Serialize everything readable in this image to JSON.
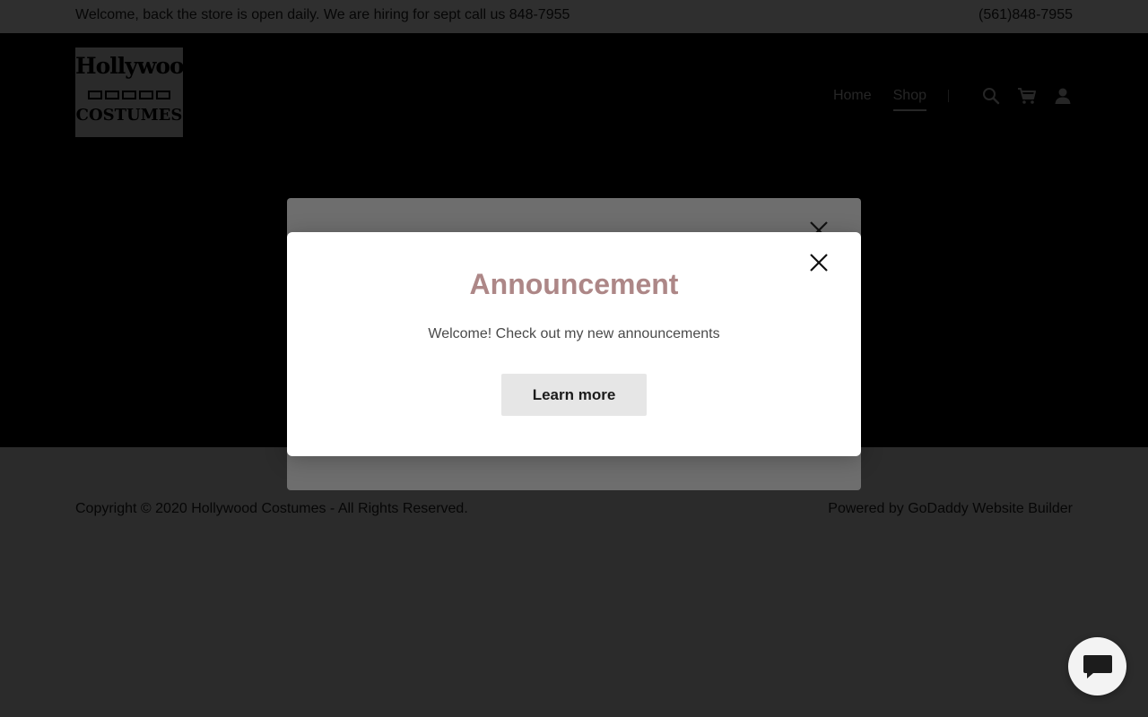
{
  "topbar": {
    "message": "Welcome, back the store is open daily. We are hiring for sept call us 848-7955",
    "phone": "(561)848-7955"
  },
  "logo": {
    "line1": "Hollywood",
    "line2": "COSTUMES"
  },
  "nav": {
    "items": [
      {
        "label": "Home",
        "active": false
      },
      {
        "label": "Shop",
        "active": true
      }
    ],
    "icons": [
      "search-icon",
      "cart-icon",
      "account-icon"
    ]
  },
  "footer": {
    "copyright": "Copyright © 2020 Hollywood Costumes - All Rights Reserved.",
    "powered": "Powered by GoDaddy Website Builder"
  },
  "modal": {
    "title": "Announcement",
    "text": "Welcome! Check out my new announcements",
    "button": "Learn more",
    "close_icon": "close-icon"
  },
  "chat": {
    "icon": "chat-icon"
  },
  "colors": {
    "title_accent": "#ad8787",
    "button_bg": "#e6e6e6",
    "overlay_dark": "#2b2b2b",
    "header_bg": "#000000"
  }
}
